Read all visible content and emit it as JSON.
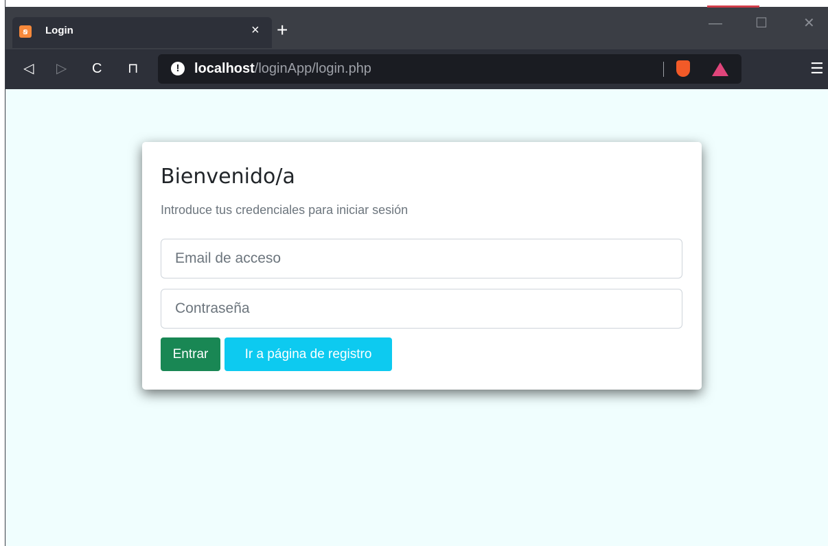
{
  "browser": {
    "tab": {
      "title": "Login",
      "close_glyph": "×",
      "favicon": "xampp-icon"
    },
    "new_tab_glyph": "+",
    "window_controls": {
      "minimize": "—",
      "maximize": "☐",
      "close": "✕"
    },
    "toolbar": {
      "back_glyph": "◁",
      "forward_glyph": "▷",
      "reload_glyph": "C",
      "bookmark_glyph": "⊓",
      "menu_glyph": "☰"
    },
    "url": {
      "info_glyph": "!",
      "host": "localhost",
      "path": "/loginApp/login.php"
    },
    "colors": {
      "tab_bg": "#2d3039",
      "toolbar_bg": "#2d3039",
      "urlbar_bg": "#1a1c22"
    }
  },
  "page": {
    "background": "#f0fefe",
    "card": {
      "title": "Bienvenido/a",
      "subtitle": "Introduce tus credenciales para iniciar sesión",
      "email_placeholder": "Email de acceso",
      "password_placeholder": "Contraseña",
      "enter_label": "Entrar",
      "register_label": "Ir a página de registro"
    },
    "colors": {
      "enter_button": "#198754",
      "register_button": "#0dcaf0"
    }
  }
}
